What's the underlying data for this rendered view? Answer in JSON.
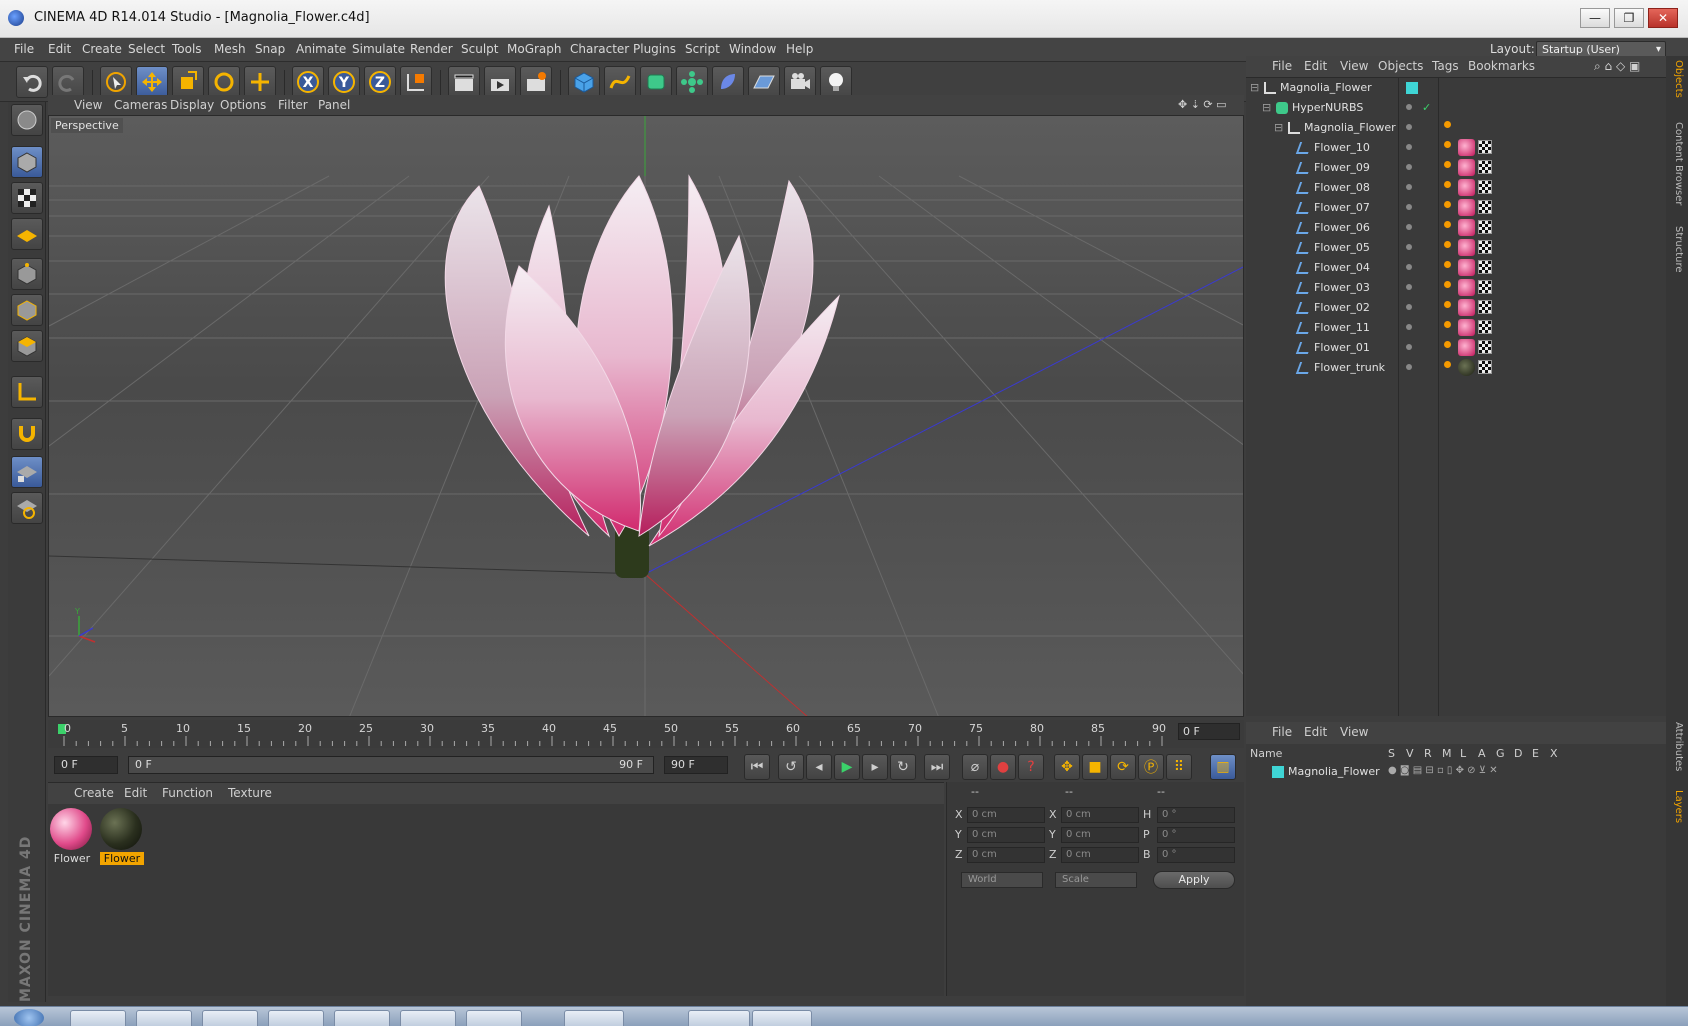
{
  "window": {
    "title": "CINEMA 4D R14.014 Studio - [Magnolia_Flower.c4d]",
    "min": "—",
    "max": "❐",
    "close": "✕"
  },
  "menu": [
    "File",
    "Edit",
    "Create",
    "Select",
    "Tools",
    "Mesh",
    "Snap",
    "Animate",
    "Simulate",
    "Render",
    "Sculpt",
    "MoGraph",
    "Character",
    "Plugins",
    "Script",
    "Window",
    "Help"
  ],
  "layout": {
    "label": "Layout:",
    "value": "Startup (User)"
  },
  "viewport": {
    "menu": [
      "View",
      "Cameras",
      "Display",
      "Options",
      "Filter",
      "Panel"
    ],
    "label": "Perspective"
  },
  "timeline": {
    "ticks": [
      "0",
      "5",
      "10",
      "15",
      "20",
      "25",
      "30",
      "35",
      "40",
      "45",
      "50",
      "55",
      "60",
      "65",
      "70",
      "75",
      "80",
      "85",
      "90"
    ],
    "current_frame": "0 F",
    "start_field": "0 F",
    "range_start": "0 F",
    "range_end": "90 F",
    "end_field": "90 F"
  },
  "material_manager": {
    "menu": [
      "Create",
      "Edit",
      "Function",
      "Texture"
    ],
    "materials": [
      {
        "label": "Flower",
        "color": "#e04a8a",
        "selected": false
      },
      {
        "label": "Flower",
        "color": "#2a2f1e",
        "selected": true
      }
    ]
  },
  "coordinates": {
    "headers": [
      "--",
      "--",
      "--"
    ],
    "rows": [
      {
        "label": "X",
        "pos": "0 cm",
        "label2": "X",
        "size": "0 cm",
        "label3": "H",
        "rot": "0 °"
      },
      {
        "label": "Y",
        "pos": "0 cm",
        "label2": "Y",
        "size": "0 cm",
        "label3": "P",
        "rot": "0 °"
      },
      {
        "label": "Z",
        "pos": "0 cm",
        "label2": "Z",
        "size": "0 cm",
        "label3": "B",
        "rot": "0 °"
      }
    ],
    "mode": "World",
    "transform": "Scale",
    "apply": "Apply"
  },
  "object_manager": {
    "menu": [
      "File",
      "Edit",
      "View",
      "Objects",
      "Tags",
      "Bookmarks"
    ],
    "root": "Magnolia_Flower",
    "hypernurbs": "HyperNURBS",
    "group": "Magnolia_Flower",
    "children": [
      "Flower_10",
      "Flower_09",
      "Flower_08",
      "Flower_07",
      "Flower_06",
      "Flower_05",
      "Flower_04",
      "Flower_03",
      "Flower_02",
      "Flower_11",
      "Flower_01",
      "Flower_trunk"
    ]
  },
  "layer_manager": {
    "menu": [
      "File",
      "Edit",
      "View"
    ],
    "columns": {
      "name": "Name",
      "flags": [
        "S",
        "V",
        "R",
        "M",
        "L",
        "A",
        "G",
        "D",
        "E",
        "X"
      ]
    },
    "layers": [
      "Magnolia_Flower"
    ]
  },
  "right_tabs": [
    "Objects",
    "Content Browser",
    "Structure",
    "Attributes",
    "Layers"
  ],
  "brand": "MAXON CINEMA 4D",
  "colors": {
    "accent": "#4e7bd1",
    "selection": "#f2a400",
    "layer": "#3fd5d5"
  }
}
